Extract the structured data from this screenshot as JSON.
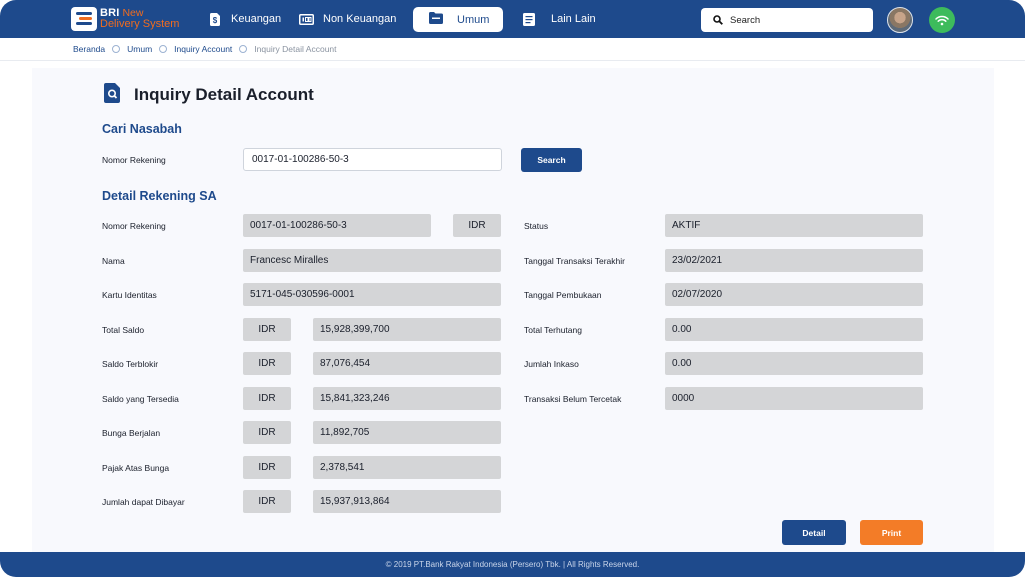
{
  "app": {
    "brand_line1": "BRI",
    "brand_new": "New",
    "brand_line2": "Delivery System"
  },
  "nav": {
    "keuangan": "Keuangan",
    "non_keuangan": "Non Keuangan",
    "umum": "Umum",
    "lain_lain": "Lain Lain"
  },
  "search": {
    "label": "Search"
  },
  "breadcrumb": {
    "b1": "Beranda",
    "b2": "Umum",
    "b3": "Inquiry Account",
    "b4": "Inquiry Detail Account"
  },
  "page": {
    "title": "Inquiry Detail Account"
  },
  "cari": {
    "heading": "Cari Nasabah",
    "label": "Nomor Rekening",
    "value": "0017-01-100286-50-3",
    "button": "Search"
  },
  "detail": {
    "heading": "Detail Rekening SA",
    "left": {
      "nomor_rekening": {
        "label": "Nomor Rekening",
        "value": "0017-01-100286-50-3",
        "currency": "IDR"
      },
      "nama": {
        "label": "Nama",
        "value": "Francesc Miralles"
      },
      "kartu": {
        "label": "Kartu Identitas",
        "value": "5171-045-030596-0001"
      },
      "total_saldo": {
        "label": "Total Saldo",
        "currency": "IDR",
        "value": "15,928,399,700"
      },
      "saldo_terblokir": {
        "label": "Saldo Terblokir",
        "currency": "IDR",
        "value": "87,076,454"
      },
      "saldo_tersedia": {
        "label": "Saldo yang Tersedia",
        "currency": "IDR",
        "value": "15,841,323,246"
      },
      "bunga": {
        "label": "Bunga Berjalan",
        "currency": "IDR",
        "value": "11,892,705"
      },
      "pajak": {
        "label": "Pajak Atas Bunga",
        "currency": "IDR",
        "value": "2,378,541"
      },
      "jumlah": {
        "label": "Jumlah dapat Dibayar",
        "currency": "IDR",
        "value": "15,937,913,864"
      }
    },
    "right": {
      "status": {
        "label": "Status",
        "value": "AKTIF"
      },
      "tgl_terakhir": {
        "label": "Tanggal Transaksi Terakhir",
        "value": "23/02/2021"
      },
      "tgl_buka": {
        "label": "Tanggal Pembukaan",
        "value": "02/07/2020"
      },
      "terhutang": {
        "label": "Total Terhutang",
        "value": "0.00"
      },
      "inkaso": {
        "label": "Jumlah Inkaso",
        "value": "0.00"
      },
      "belum_cetak": {
        "label": "Transaksi Belum Tercetak",
        "value": "0000"
      }
    }
  },
  "actions": {
    "detail": "Detail",
    "print": "Print"
  },
  "footer": {
    "text": "© 2019 PT.Bank Rakyat Indonesia (Persero) Tbk. | All Rights Reserved."
  },
  "colors": {
    "primary": "#1e4a8c",
    "accent": "#f37c27",
    "online": "#3dbb5c"
  }
}
